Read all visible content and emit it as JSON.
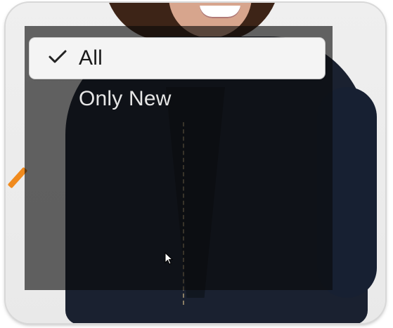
{
  "menu": {
    "items": [
      {
        "label": "All",
        "selected": true,
        "icon": "check-icon"
      },
      {
        "label": "Only New",
        "selected": false
      }
    ]
  },
  "colors": {
    "overlay": "#0a0a0a",
    "selected_bg": "#f4f4f4",
    "selected_text": "#1a1a1a",
    "unselected_text": "#e6e6e6"
  },
  "cursor": {
    "icon": "cursor-icon"
  }
}
